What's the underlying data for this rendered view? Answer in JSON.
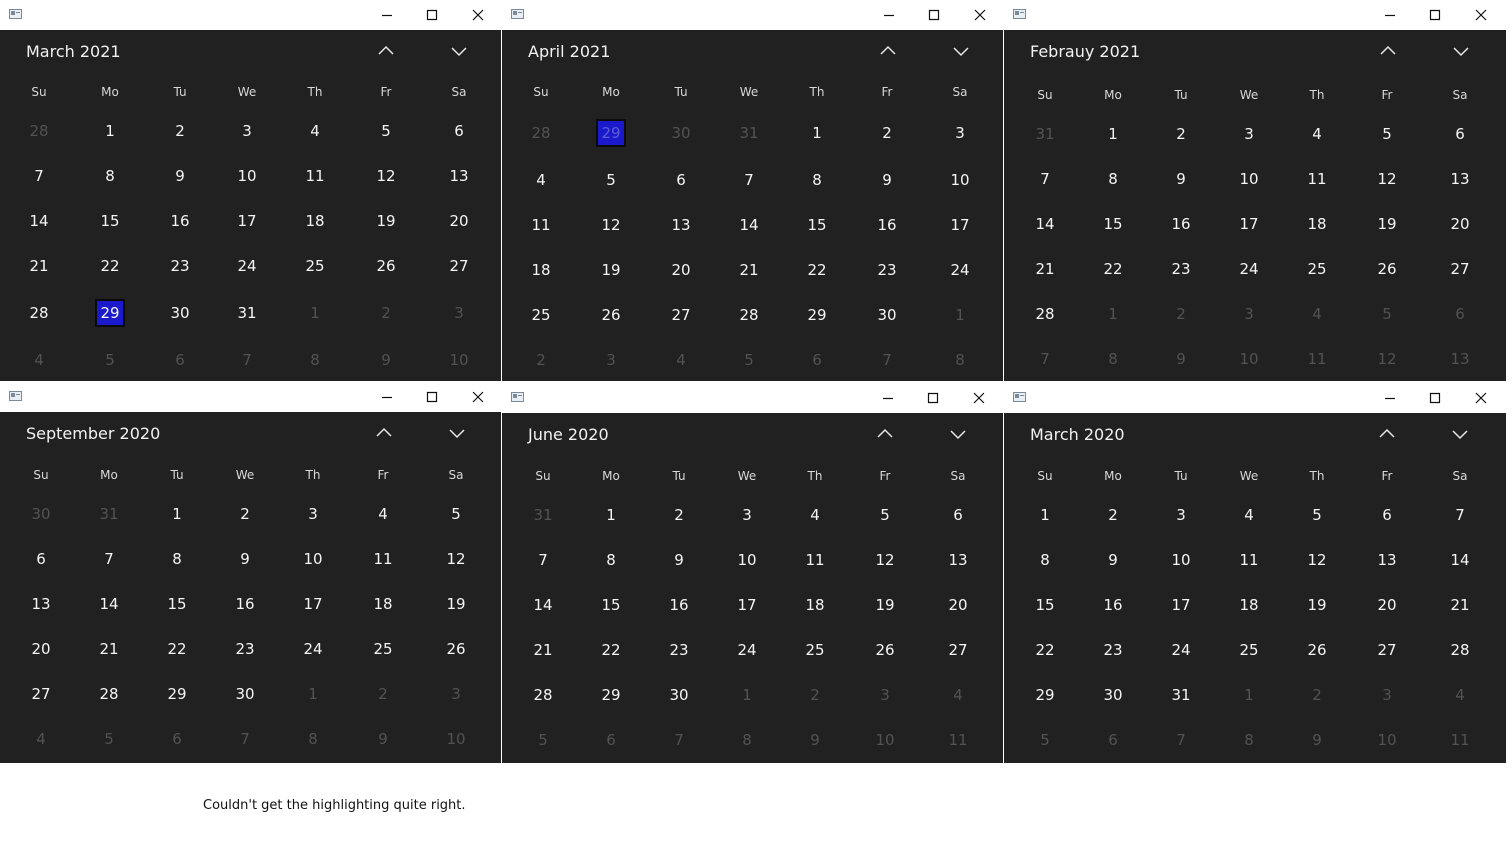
{
  "days_of_week": [
    "Su",
    "Mo",
    "Tu",
    "We",
    "Th",
    "Fr",
    "Sa"
  ],
  "windows": [
    {
      "month_label": "March 2021",
      "weeks": [
        [
          {
            "d": "28",
            "o": true
          },
          {
            "d": "1"
          },
          {
            "d": "2"
          },
          {
            "d": "3"
          },
          {
            "d": "4"
          },
          {
            "d": "5"
          },
          {
            "d": "6"
          }
        ],
        [
          {
            "d": "7"
          },
          {
            "d": "8"
          },
          {
            "d": "9"
          },
          {
            "d": "10"
          },
          {
            "d": "11"
          },
          {
            "d": "12"
          },
          {
            "d": "13"
          }
        ],
        [
          {
            "d": "14"
          },
          {
            "d": "15"
          },
          {
            "d": "16"
          },
          {
            "d": "17"
          },
          {
            "d": "18"
          },
          {
            "d": "19"
          },
          {
            "d": "20"
          }
        ],
        [
          {
            "d": "21"
          },
          {
            "d": "22"
          },
          {
            "d": "23"
          },
          {
            "d": "24"
          },
          {
            "d": "25"
          },
          {
            "d": "26"
          },
          {
            "d": "27"
          }
        ],
        [
          {
            "d": "28"
          },
          {
            "d": "29",
            "s": true
          },
          {
            "d": "30"
          },
          {
            "d": "31"
          },
          {
            "d": "1",
            "o": true
          },
          {
            "d": "2",
            "o": true
          },
          {
            "d": "3",
            "o": true
          }
        ],
        [
          {
            "d": "4",
            "o": true
          },
          {
            "d": "5",
            "o": true
          },
          {
            "d": "6",
            "o": true
          },
          {
            "d": "7",
            "o": true
          },
          {
            "d": "8",
            "o": true
          },
          {
            "d": "9",
            "o": true
          },
          {
            "d": "10",
            "o": true
          }
        ]
      ]
    },
    {
      "month_label": "April 2021",
      "weeks": [
        [
          {
            "d": "28",
            "o": true
          },
          {
            "d": "29",
            "o": true,
            "s": true
          },
          {
            "d": "30",
            "o": true
          },
          {
            "d": "31",
            "o": true
          },
          {
            "d": "1"
          },
          {
            "d": "2"
          },
          {
            "d": "3"
          }
        ],
        [
          {
            "d": "4"
          },
          {
            "d": "5"
          },
          {
            "d": "6"
          },
          {
            "d": "7"
          },
          {
            "d": "8"
          },
          {
            "d": "9"
          },
          {
            "d": "10"
          }
        ],
        [
          {
            "d": "11"
          },
          {
            "d": "12"
          },
          {
            "d": "13"
          },
          {
            "d": "14"
          },
          {
            "d": "15"
          },
          {
            "d": "16"
          },
          {
            "d": "17"
          }
        ],
        [
          {
            "d": "18"
          },
          {
            "d": "19"
          },
          {
            "d": "20"
          },
          {
            "d": "21"
          },
          {
            "d": "22"
          },
          {
            "d": "23"
          },
          {
            "d": "24"
          }
        ],
        [
          {
            "d": "25"
          },
          {
            "d": "26"
          },
          {
            "d": "27"
          },
          {
            "d": "28"
          },
          {
            "d": "29"
          },
          {
            "d": "30"
          },
          {
            "d": "1",
            "o": true
          }
        ],
        [
          {
            "d": "2",
            "o": true
          },
          {
            "d": "3",
            "o": true
          },
          {
            "d": "4",
            "o": true
          },
          {
            "d": "5",
            "o": true
          },
          {
            "d": "6",
            "o": true
          },
          {
            "d": "7",
            "o": true
          },
          {
            "d": "8",
            "o": true
          }
        ]
      ]
    },
    {
      "month_label": "Febrauy 2021",
      "weeks": [
        [
          {
            "d": "31",
            "o": true
          },
          {
            "d": "1"
          },
          {
            "d": "2"
          },
          {
            "d": "3"
          },
          {
            "d": "4"
          },
          {
            "d": "5"
          },
          {
            "d": "6"
          }
        ],
        [
          {
            "d": "7"
          },
          {
            "d": "8"
          },
          {
            "d": "9"
          },
          {
            "d": "10"
          },
          {
            "d": "11"
          },
          {
            "d": "12"
          },
          {
            "d": "13"
          }
        ],
        [
          {
            "d": "14"
          },
          {
            "d": "15"
          },
          {
            "d": "16"
          },
          {
            "d": "17"
          },
          {
            "d": "18"
          },
          {
            "d": "19"
          },
          {
            "d": "20"
          }
        ],
        [
          {
            "d": "21"
          },
          {
            "d": "22"
          },
          {
            "d": "23"
          },
          {
            "d": "24"
          },
          {
            "d": "25"
          },
          {
            "d": "26"
          },
          {
            "d": "27"
          }
        ],
        [
          {
            "d": "28"
          },
          {
            "d": "1",
            "o": true
          },
          {
            "d": "2",
            "o": true
          },
          {
            "d": "3",
            "o": true
          },
          {
            "d": "4",
            "o": true
          },
          {
            "d": "5",
            "o": true
          },
          {
            "d": "6",
            "o": true
          }
        ],
        [
          {
            "d": "7",
            "o": true
          },
          {
            "d": "8",
            "o": true
          },
          {
            "d": "9",
            "o": true
          },
          {
            "d": "10",
            "o": true
          },
          {
            "d": "11",
            "o": true
          },
          {
            "d": "12",
            "o": true
          },
          {
            "d": "13",
            "o": true
          }
        ]
      ]
    },
    {
      "month_label": "September 2020",
      "weeks": [
        [
          {
            "d": "30",
            "o": true
          },
          {
            "d": "31",
            "o": true
          },
          {
            "d": "1"
          },
          {
            "d": "2"
          },
          {
            "d": "3"
          },
          {
            "d": "4"
          },
          {
            "d": "5"
          }
        ],
        [
          {
            "d": "6"
          },
          {
            "d": "7"
          },
          {
            "d": "8"
          },
          {
            "d": "9"
          },
          {
            "d": "10"
          },
          {
            "d": "11"
          },
          {
            "d": "12"
          }
        ],
        [
          {
            "d": "13"
          },
          {
            "d": "14"
          },
          {
            "d": "15"
          },
          {
            "d": "16"
          },
          {
            "d": "17"
          },
          {
            "d": "18"
          },
          {
            "d": "19"
          }
        ],
        [
          {
            "d": "20"
          },
          {
            "d": "21"
          },
          {
            "d": "22"
          },
          {
            "d": "23"
          },
          {
            "d": "24"
          },
          {
            "d": "25"
          },
          {
            "d": "26"
          }
        ],
        [
          {
            "d": "27"
          },
          {
            "d": "28"
          },
          {
            "d": "29"
          },
          {
            "d": "30"
          },
          {
            "d": "1",
            "o": true
          },
          {
            "d": "2",
            "o": true
          },
          {
            "d": "3",
            "o": true
          }
        ],
        [
          {
            "d": "4",
            "o": true
          },
          {
            "d": "5",
            "o": true
          },
          {
            "d": "6",
            "o": true
          },
          {
            "d": "7",
            "o": true
          },
          {
            "d": "8",
            "o": true
          },
          {
            "d": "9",
            "o": true
          },
          {
            "d": "10",
            "o": true
          }
        ]
      ]
    },
    {
      "month_label": "June 2020",
      "weeks": [
        [
          {
            "d": "31",
            "o": true
          },
          {
            "d": "1"
          },
          {
            "d": "2"
          },
          {
            "d": "3"
          },
          {
            "d": "4"
          },
          {
            "d": "5"
          },
          {
            "d": "6"
          }
        ],
        [
          {
            "d": "7"
          },
          {
            "d": "8"
          },
          {
            "d": "9"
          },
          {
            "d": "10"
          },
          {
            "d": "11"
          },
          {
            "d": "12"
          },
          {
            "d": "13"
          }
        ],
        [
          {
            "d": "14"
          },
          {
            "d": "15"
          },
          {
            "d": "16"
          },
          {
            "d": "17"
          },
          {
            "d": "18"
          },
          {
            "d": "19"
          },
          {
            "d": "20"
          }
        ],
        [
          {
            "d": "21"
          },
          {
            "d": "22"
          },
          {
            "d": "23"
          },
          {
            "d": "24"
          },
          {
            "d": "25"
          },
          {
            "d": "26"
          },
          {
            "d": "27"
          }
        ],
        [
          {
            "d": "28"
          },
          {
            "d": "29"
          },
          {
            "d": "30"
          },
          {
            "d": "1",
            "o": true
          },
          {
            "d": "2",
            "o": true
          },
          {
            "d": "3",
            "o": true
          },
          {
            "d": "4",
            "o": true
          }
        ],
        [
          {
            "d": "5",
            "o": true
          },
          {
            "d": "6",
            "o": true
          },
          {
            "d": "7",
            "o": true
          },
          {
            "d": "8",
            "o": true
          },
          {
            "d": "9",
            "o": true
          },
          {
            "d": "10",
            "o": true
          },
          {
            "d": "11",
            "o": true
          }
        ]
      ]
    },
    {
      "month_label": "March 2020",
      "weeks": [
        [
          {
            "d": "1"
          },
          {
            "d": "2"
          },
          {
            "d": "3"
          },
          {
            "d": "4"
          },
          {
            "d": "5"
          },
          {
            "d": "6"
          },
          {
            "d": "7"
          }
        ],
        [
          {
            "d": "8"
          },
          {
            "d": "9"
          },
          {
            "d": "10"
          },
          {
            "d": "11"
          },
          {
            "d": "12"
          },
          {
            "d": "13"
          },
          {
            "d": "14"
          }
        ],
        [
          {
            "d": "15"
          },
          {
            "d": "16"
          },
          {
            "d": "17"
          },
          {
            "d": "18"
          },
          {
            "d": "19"
          },
          {
            "d": "20"
          },
          {
            "d": "21"
          }
        ],
        [
          {
            "d": "22"
          },
          {
            "d": "23"
          },
          {
            "d": "24"
          },
          {
            "d": "25"
          },
          {
            "d": "26"
          },
          {
            "d": "27"
          },
          {
            "d": "28"
          }
        ],
        [
          {
            "d": "29"
          },
          {
            "d": "30"
          },
          {
            "d": "31"
          },
          {
            "d": "1",
            "o": true
          },
          {
            "d": "2",
            "o": true
          },
          {
            "d": "3",
            "o": true
          },
          {
            "d": "4",
            "o": true
          }
        ],
        [
          {
            "d": "5",
            "o": true
          },
          {
            "d": "6",
            "o": true
          },
          {
            "d": "7",
            "o": true
          },
          {
            "d": "8",
            "o": true
          },
          {
            "d": "9",
            "o": true
          },
          {
            "d": "10",
            "o": true
          },
          {
            "d": "11",
            "o": true
          }
        ]
      ]
    }
  ],
  "caption": "Couldn't get the highlighting quite right.",
  "icons": {
    "app": "app-icon",
    "minimize": "minimize-icon",
    "maximize": "maximize-icon",
    "close": "close-icon",
    "previous": "chevron-up-icon",
    "next": "chevron-down-icon"
  },
  "colors": {
    "calendar_background": "#212121",
    "selected_day_background": "#1a1acc",
    "day_text": "#f5f5f5",
    "outside_month_day_text": "#525252"
  }
}
